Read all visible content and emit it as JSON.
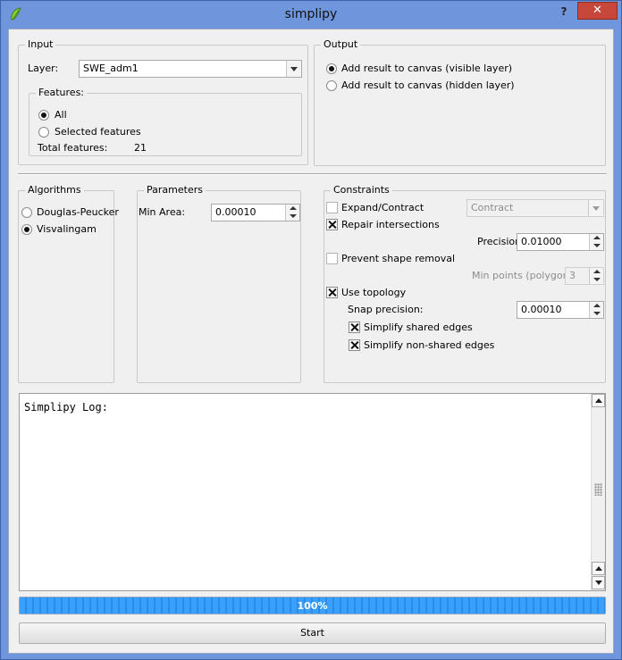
{
  "window": {
    "title": "simplipy",
    "help_label": "?",
    "close_label": "✕"
  },
  "input": {
    "group_title": "Input",
    "layer_label": "Layer:",
    "layer_value": "SWE_adm1",
    "features": {
      "group_title": "Features:",
      "all_label": "All",
      "selected_label": "Selected features",
      "selected_option": "All",
      "total_label": "Total features:",
      "total_value": "21"
    }
  },
  "output": {
    "group_title": "Output",
    "visible_label": "Add result to canvas (visible layer)",
    "hidden_label": "Add result to canvas (hidden layer)",
    "selected_option": "visible"
  },
  "algorithms": {
    "group_title": "Algorithms",
    "douglas_label": "Douglas-Peucker",
    "visvalingam_label": "Visvalingam",
    "selected_option": "Visvalingam"
  },
  "parameters": {
    "group_title": "Parameters",
    "min_area_label": "Min Area:",
    "min_area_value": "0.00010"
  },
  "constraints": {
    "group_title": "Constraints",
    "expand_label": "Expand/Contract",
    "expand_checked": false,
    "expand_mode": "Contract",
    "repair_label": "Repair intersections",
    "repair_checked": true,
    "precision_label": "Precision",
    "precision_value": "0.01000",
    "prevent_label": "Prevent shape removal",
    "prevent_checked": false,
    "min_points_label": "Min points (polygons)",
    "min_points_value": "3",
    "topology_label": "Use topology",
    "topology_checked": true,
    "snap_label": "Snap precision:",
    "snap_value": "0.00010",
    "shared_label": "Simplify shared edges",
    "shared_checked": true,
    "nonshared_label": "Simplify non-shared edges",
    "nonshared_checked": true
  },
  "log": {
    "text": "Simplipy Log:"
  },
  "progress": {
    "percent": 100,
    "label": "100%"
  },
  "start_label": "Start",
  "colors": {
    "frame": "#6f96dc",
    "close": "#c7473a",
    "progress": "#2e8ef0"
  }
}
